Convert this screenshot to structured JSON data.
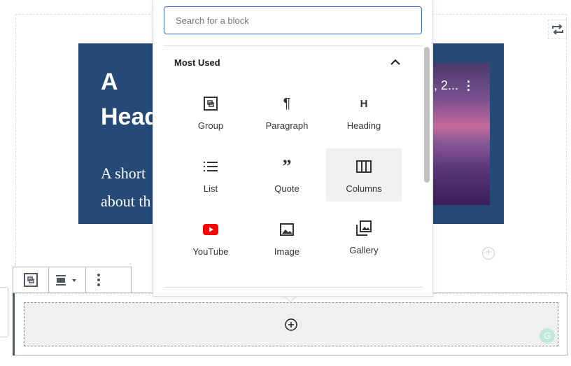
{
  "media_text": {
    "heading": "A Heading",
    "paragraph_line1": "A short",
    "paragraph_line2": "about th",
    "image_caption": ", 2..."
  },
  "inserter": {
    "search_placeholder": "Search for a block",
    "section_title": "Most Used",
    "blocks": [
      {
        "label": "Group",
        "icon": "group-icon"
      },
      {
        "label": "Paragraph",
        "icon": "paragraph-icon"
      },
      {
        "label": "Heading",
        "icon": "heading-icon"
      },
      {
        "label": "List",
        "icon": "list-icon"
      },
      {
        "label": "Quote",
        "icon": "quote-icon"
      },
      {
        "label": "Columns",
        "icon": "columns-icon",
        "highlighted": true
      },
      {
        "label": "YouTube",
        "icon": "youtube-icon"
      },
      {
        "label": "Image",
        "icon": "image-icon"
      },
      {
        "label": "Gallery",
        "icon": "gallery-icon"
      }
    ]
  },
  "colors": {
    "media_bg": "#254a77",
    "accent": "#3c6fc4",
    "youtube": "#ff0000"
  }
}
